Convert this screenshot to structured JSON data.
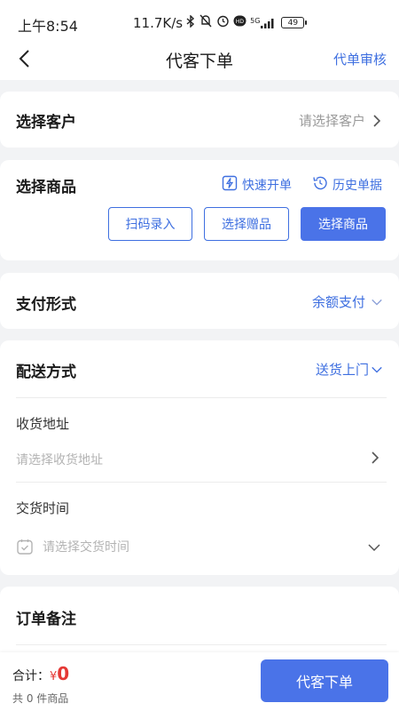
{
  "status_bar": {
    "time": "上午8:54",
    "speed": "11.7K/s",
    "network": "5G",
    "battery": "49"
  },
  "nav": {
    "title": "代客下单",
    "action_label": "代单审核"
  },
  "customer": {
    "title": "选择客户",
    "placeholder": "请选择客户"
  },
  "goods": {
    "title": "选择商品",
    "quick_order_label": "快速开单",
    "history_label": "历史单据",
    "buttons": {
      "scan": "扫码录入",
      "gift": "选择赠品",
      "select": "选择商品"
    }
  },
  "payment": {
    "title": "支付形式",
    "value": "余额支付"
  },
  "delivery": {
    "title": "配送方式",
    "value": "送货上门",
    "address_label": "收货地址",
    "address_placeholder": "请选择收货地址",
    "time_label": "交货时间",
    "time_placeholder": "请选择交货时间"
  },
  "remark": {
    "title": "订单备注"
  },
  "footer": {
    "total_label": "合计：",
    "currency": "¥",
    "total": "0",
    "count_text": "共 0 件商品",
    "submit_label": "代客下单"
  },
  "colors": {
    "accent": "#3e6fe0",
    "primary_button": "#4a73e8",
    "price": "#e53935",
    "background": "#f2f3f5"
  }
}
